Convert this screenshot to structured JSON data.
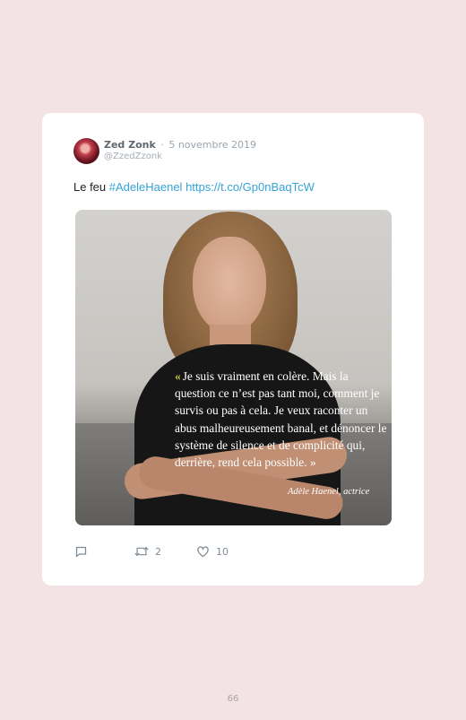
{
  "tweet": {
    "author_name": "Zed Zonk",
    "separator": "·",
    "date": "5 novembre 2019",
    "handle": "@ZzedZzonk",
    "text_plain": "Le feu ",
    "hashtag": "#AdeleHaenel",
    "link": "https://t.co/Gp0nBaqTcW",
    "image": {
      "quote_mark": "«",
      "quote_first_letter": "J",
      "quote_text": "e suis vraiment en colère. Mais la question ce n’est pas tant moi, comment je survis ou pas à cela. Je veux raconter un abus malheureusement banal, et dénoncer le système de silence et de complicité qui, derrière, rend cela possible. »",
      "attribution": "Adèle Haenel, actrice"
    },
    "actions": {
      "reply_icon": "reply-icon",
      "retweet_icon": "retweet-icon",
      "retweet_count": "2",
      "like_icon": "heart-icon",
      "like_count": "10"
    }
  },
  "page_number": "66",
  "colors": {
    "background": "#f4e3e4",
    "card": "#ffffff",
    "link": "#35a3d8",
    "quote_accent": "#c4c34a"
  }
}
